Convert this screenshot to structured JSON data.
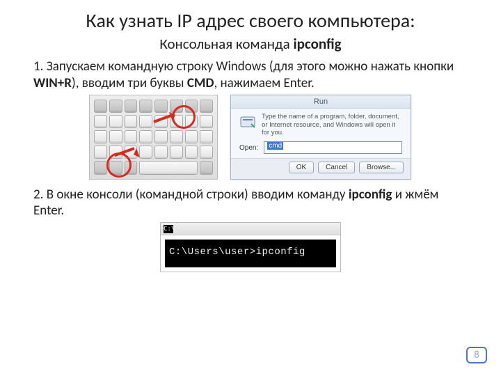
{
  "title": "Как узнать IP адрес своего компьютера:",
  "subtitle_pre": "Консольная команда ",
  "subtitle_cmd": "ipconfig",
  "step1_pre": "1. Запускаем командную строку Windows (для этого можно нажать кнопки ",
  "step1_keys": "WIN+R",
  "step1_mid": "), вводим три буквы ",
  "step1_cmd": "CMD",
  "step1_post": ", нажимаем Enter.",
  "run_dialog": {
    "title": "Run",
    "hint": "Type the name of a program, folder, document, or Internet resource, and Windows will open it for you.",
    "open_label": "Open:",
    "open_value": "cmd",
    "buttons": {
      "ok": "OK",
      "cancel": "Cancel",
      "browse": "Browse..."
    }
  },
  "step2_pre": "2. В окне консоли (командной строки) вводим команду ",
  "step2_cmd": "ipconfig",
  "step2_post": " и жмём Enter.",
  "console": {
    "icon": "C:\\",
    "line": "C:\\Users\\user>ipconfig"
  },
  "page_number": "8"
}
